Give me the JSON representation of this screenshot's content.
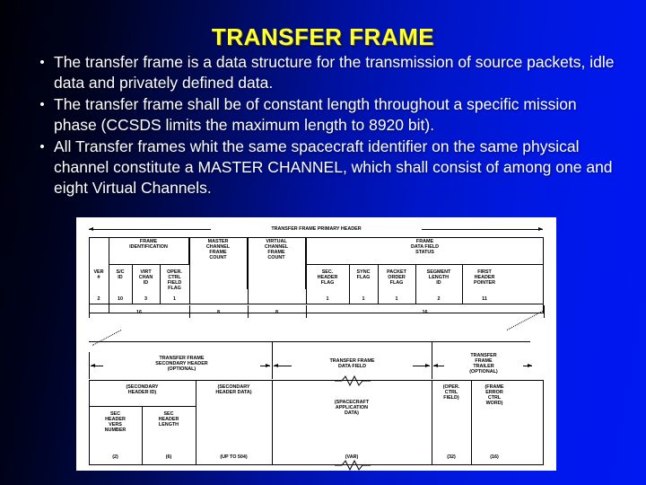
{
  "slide": {
    "title": "TRANSFER FRAME",
    "title_color": "#ffff33",
    "text_color": "#ffffff",
    "background_colors": [
      "#000008",
      "#0019f2"
    ],
    "bullets": [
      "The transfer frame is a data structure for the transmission of source packets, idle data and privately defined data.",
      "The transfer frame shall be of constant length throughout a specific mission phase (CCSDS limits the maximum length to 8920 bit).",
      "All Transfer frames whit the same spacecraft identifier on the same physical channel constitute a MASTER CHANNEL, which shall consist of among one and eight Virtual Channels.",
      "•"
    ],
    "bullet_marker": "•"
  },
  "diagram": {
    "primary_header_label": "TRANSFER FRAME PRIMARY HEADER",
    "row2": {
      "frame_identification": "FRAME\nIDENTIFICATION",
      "master_channel_frame_count": "MASTER\nCHANNEL\nFRAME\nCOUNT",
      "virtual_channel_frame_count": "VIRTUAL\nCHANNEL\nFRAME\nCOUNT",
      "frame_data_field_status": "FRAME\nDATA FIELD\nSTATUS"
    },
    "row3": [
      {
        "label": "VER\n#",
        "bits": "2"
      },
      {
        "label": "S/C\nID",
        "bits": "10"
      },
      {
        "label": "VIRT\nCHAN\nID",
        "bits": "3"
      },
      {
        "label": "OPER.\nCTRL\nFIELD\nFLAG",
        "bits": "1"
      },
      {
        "label": "SEC.\nHEADER\nFLAG",
        "bits": "1"
      },
      {
        "label": "SYNC\nFLAG",
        "bits": "1"
      },
      {
        "label": "PACKET\nORDER\nFLAG",
        "bits": "1"
      },
      {
        "label": "SEGMENT\nLENGTH\nID",
        "bits": "2"
      },
      {
        "label": "FIRST\nHEADER\nPOINTER",
        "bits": "11"
      }
    ],
    "group_bits": [
      "16",
      "8",
      "8",
      "16"
    ],
    "section_labels": {
      "secondary_header": "TRANSFER FRAME\nSECONDARY HEADER\n(OPTIONAL)",
      "data_field": "TRANSFER FRAME\nDATA FIELD",
      "trailer": "TRANSFER\nFRAME\nTRAILER\n(OPTIONAL)"
    },
    "bottom_cells": [
      {
        "label": "(SECONDARY\nHEADER ID)",
        "sub": "",
        "bits": ""
      },
      {
        "label": "SEC\nHEADER\nVERS\nNUMBER",
        "bits": "(2)"
      },
      {
        "label": "SEC\nHEADER\nLENGTH",
        "bits": "(6)"
      },
      {
        "label": "(SECONDARY\nHEADER DATA)",
        "bits": "(UP TO 504)"
      },
      {
        "label": "(SPACECRAFT\nAPPLICATION\nDATA)",
        "bits": "(VAR)"
      },
      {
        "label": "(OPER.\nCTRL\nFIELD)",
        "bits": "(32)"
      },
      {
        "label": "(FRAME\nERROR\nCTRL\nWORD)",
        "bits": "(16)"
      }
    ]
  }
}
